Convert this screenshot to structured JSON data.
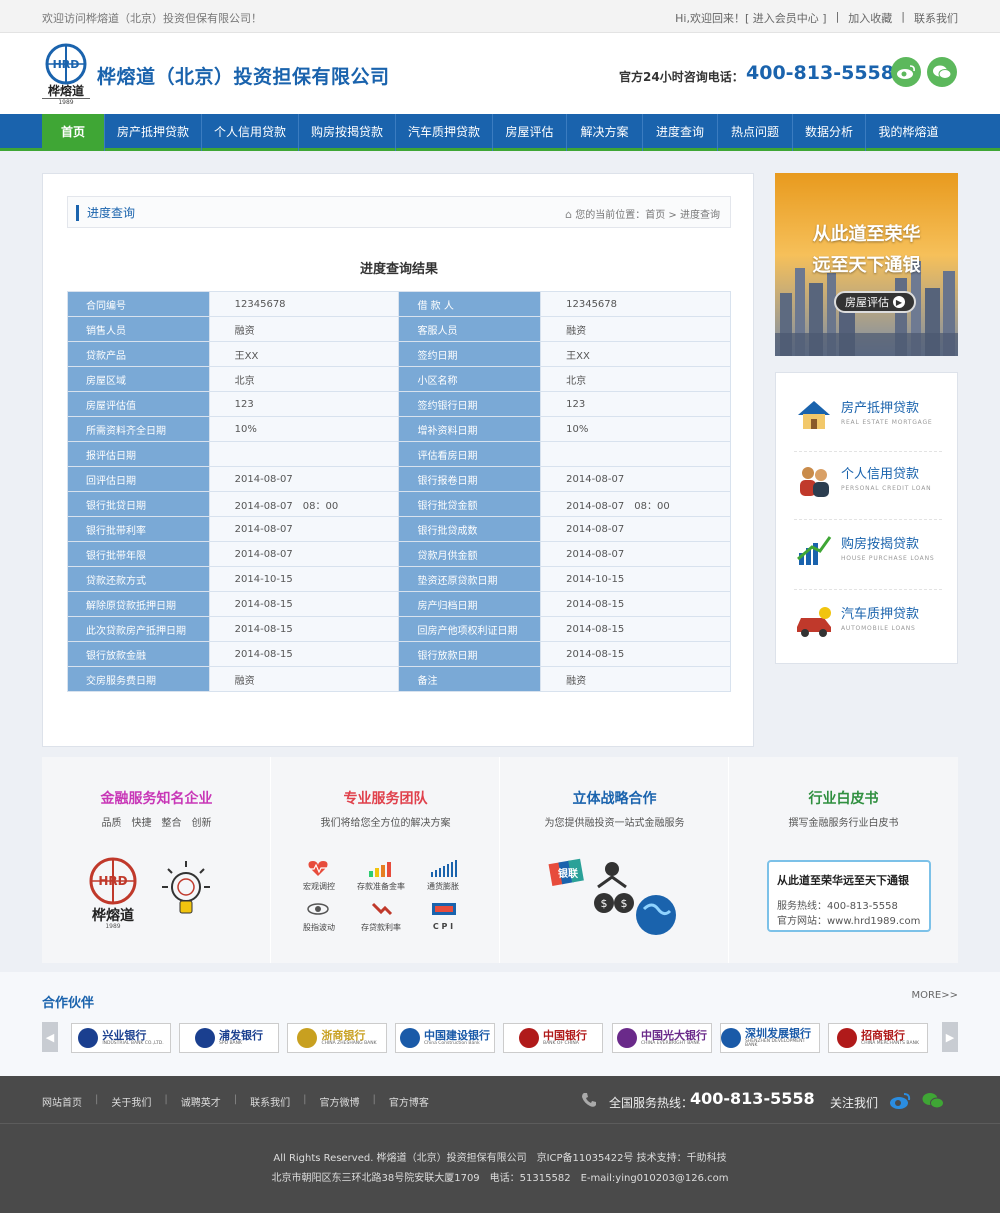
{
  "topbar": {
    "welcome": "欢迎访问桦熔道（北京）投资但保有限公司！",
    "hi": "Hi,欢迎回来！",
    "member_link": "[ 进入会员中心 ]",
    "bookmark": "加入收藏",
    "contact": "联系我们"
  },
  "header": {
    "logo_text": "桦熔道",
    "logo_year": "1989",
    "logo_letters": "HRD",
    "company": "桦熔道（北京）投资担保有限公司",
    "hotline_label": "官方24小时咨询电话：",
    "hotline": "400-813-5558"
  },
  "nav": {
    "items": [
      {
        "label": "首页",
        "w": 63,
        "active": true
      },
      {
        "label": "房产抵押贷款",
        "w": 97
      },
      {
        "label": "个人信用贷款",
        "w": 97
      },
      {
        "label": "购房按揭贷款",
        "w": 97
      },
      {
        "label": "汽车质押贷款",
        "w": 97
      },
      {
        "label": "房屋评估",
        "w": 74
      },
      {
        "label": "解决方案",
        "w": 76
      },
      {
        "label": "进度查询",
        "w": 75
      },
      {
        "label": "热点问题",
        "w": 75
      },
      {
        "label": "数据分析",
        "w": 73
      },
      {
        "label": "我的桦熔道",
        "w": 85
      }
    ]
  },
  "content": {
    "section_title": "进度查询",
    "location": "您的当前位置：首页 > 进度查询",
    "result_title": "进度查询结果",
    "rows": [
      [
        "合同编号",
        "12345678",
        "借 款 人",
        "12345678"
      ],
      [
        "销售人员",
        "融资",
        "客服人员",
        "融资"
      ],
      [
        "贷款产品",
        "王XX",
        "签约日期",
        "王XX"
      ],
      [
        "房屋区域",
        "北京",
        "小区名称",
        "北京"
      ],
      [
        "房屋评估值",
        "123",
        "签约银行日期",
        "123"
      ],
      [
        "所需资料齐全日期",
        "10%",
        "增补资料日期",
        "10%"
      ],
      [
        "报评估日期",
        "",
        "评估看房日期",
        ""
      ],
      [
        "回评估日期",
        "2014-08-07",
        "银行报卷日期",
        "2014-08-07"
      ],
      [
        "银行批贷日期",
        "2014-08-07　08：00",
        "银行批贷金额",
        "2014-08-07　08：00"
      ],
      [
        "银行批带利率",
        "2014-08-07",
        "银行批贷成数",
        "2014-08-07"
      ],
      [
        "银行批带年限",
        "2014-08-07",
        "贷款月供金额",
        "2014-08-07"
      ],
      [
        "贷款还款方式",
        "2014-10-15",
        "垫资还原贷款日期",
        "2014-10-15"
      ],
      [
        "解除原贷款抵押日期",
        "2014-08-15",
        "房产归档日期",
        "2014-08-15"
      ],
      [
        "此次贷款房产抵押日期",
        "2014-08-15",
        "回房产他项权利证日期",
        "2014-08-15"
      ],
      [
        "银行放款金融",
        "2014-08-15",
        "银行放款日期",
        "2014-08-15"
      ],
      [
        "交房服务费日期",
        "融资",
        "备注",
        "融资"
      ]
    ]
  },
  "side": {
    "banner_line1": "从此道至荣华",
    "banner_line2": "远至天下通银",
    "banner_button": "房屋评估",
    "services": [
      {
        "title": "房产抵押贷款",
        "sub": "REAL ESTATE MORTGAGE",
        "icon": "house-icon"
      },
      {
        "title": "个人信用贷款",
        "sub": "PERSONAL CREDIT LOAN",
        "icon": "people-icon"
      },
      {
        "title": "购房按揭贷款",
        "sub": "HOUSE PURCHASE LOANS",
        "icon": "chart-icon"
      },
      {
        "title": "汽车质押贷款",
        "sub": "AUTOMOBILE LOANS",
        "icon": "car-icon"
      }
    ]
  },
  "features": [
    {
      "title": "金融服务知名企业",
      "sub": "品质　快捷　整合　创新",
      "color": "#c837b7"
    },
    {
      "title": "专业服务团队",
      "sub": "我们将给您全方位的解决方案",
      "color": "#e0414c"
    },
    {
      "title": "立体战略合作",
      "sub": "为您提供融投资一站式金融服务",
      "color": "#1a63ad"
    },
    {
      "title": "行业白皮书",
      "sub": "撰写金融服务行业白皮书",
      "color": "#2f8f3f"
    }
  ],
  "team_items": [
    "宏观调控",
    "存款准备金率",
    "通货膨胀",
    "股指波动",
    "存贷款利率",
    "C P I"
  ],
  "whitepaper": {
    "headline": "从此道至荣华远至天下通银",
    "service_line": "服务热线：400-813-5558",
    "site_line": "官方网站：www.hrd1989.com"
  },
  "unionpay": "银联",
  "partners": {
    "title": "合作伙伴",
    "more": "MORE>>",
    "banks": [
      {
        "name": "兴业银行",
        "en": "INDUSTRIAL BANK CO.,LTD.",
        "color": "#1a3f8f"
      },
      {
        "name": "浦发银行",
        "en": "SPD BANK",
        "color": "#1a3f8f"
      },
      {
        "name": "浙商银行",
        "en": "CHINA ZHESHANG BANK",
        "color": "#c8a020"
      },
      {
        "name": "中国建设银行",
        "en": "China Construction Bank",
        "color": "#1a5aa8"
      },
      {
        "name": "中国银行",
        "en": "BANK OF CHINA",
        "color": "#b01a1a"
      },
      {
        "name": "中国光大银行",
        "en": "CHINA EVERBRIGHT BANK",
        "color": "#6a2a8a"
      },
      {
        "name": "深圳发展银行",
        "en": "SHENZHEN DEVELOPMENT BANK",
        "color": "#1a5aa8"
      },
      {
        "name": "招商银行",
        "en": "CHINA MERCHANTS BANK",
        "color": "#b01a1a"
      }
    ]
  },
  "footer": {
    "links": [
      "网站首页",
      "关于我们",
      "诚聘英才",
      "联系我们",
      "官方微博",
      "官方博客"
    ],
    "service_label": "全国服务热线：",
    "service_number": "400-813-5558",
    "follow": "关注我们",
    "copyright": "All Rights Reserved.  桦熔道（北京）投资担保有限公司　京ICP备11035422号  技术支持：千助科技",
    "address": "北京市朝阳区东三环北路38号院安联大厦1709　电话：51315582　E-mail:ying010203@126.com"
  }
}
